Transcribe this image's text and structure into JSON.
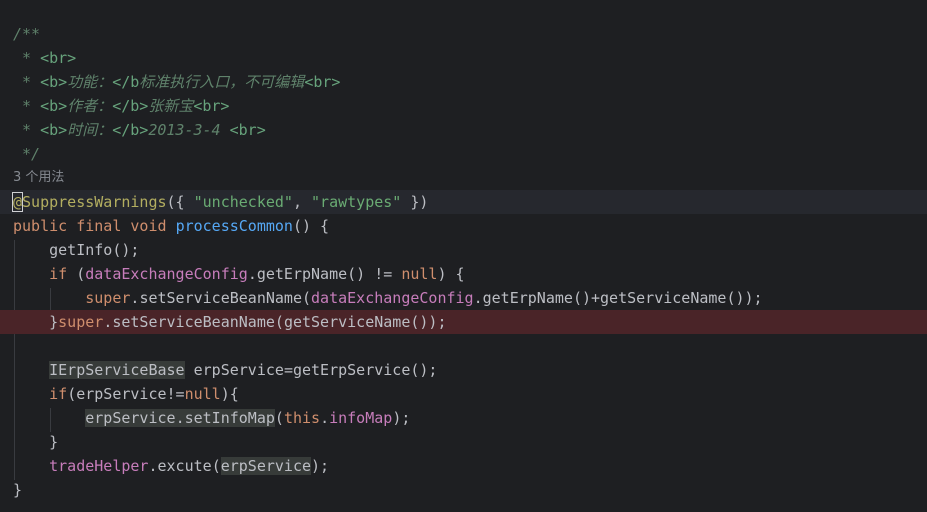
{
  "editor": {
    "javadoc": {
      "open": "/**",
      "line_br": "<br>",
      "b_open": "<b>",
      "b_close": "</b>",
      "b_close_nogt": "</b",
      "func_label": "功能：",
      "func_value": "标准执行入口，不可编辑",
      "author_label": "作者：",
      "author_value": "张新宝",
      "date_label": "时间：",
      "date_value": "2013-3-4",
      "close": "*/"
    },
    "usages_hint": "3 个用法",
    "annotation": {
      "at": "@",
      "name": "SuppressWarnings",
      "arg1": "\"unchecked\"",
      "arg2": "\"rawtypes\""
    },
    "method": {
      "modifiers": "public final void",
      "name": "processCommon"
    },
    "identifiers": {
      "getInfo": "getInfo",
      "kw_if": "if",
      "dataExchangeConfig": "dataExchangeConfig",
      "getErpName": "getErpName",
      "kw_null": "null",
      "kw_super": "super",
      "setServiceBeanName": "setServiceBeanName",
      "getServiceName": "getServiceName",
      "IErpServiceBase": "IErpServiceBase",
      "erpService": "erpService",
      "getErpService": "getErpService",
      "setInfoMap": "setInfoMap",
      "kw_this": "this",
      "infoMap": "infoMap",
      "tradeHelper": "tradeHelper",
      "excute": "excute"
    }
  }
}
